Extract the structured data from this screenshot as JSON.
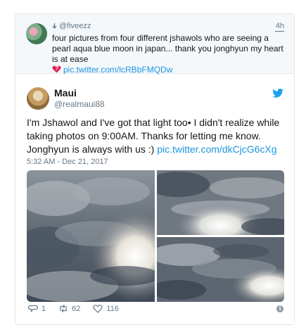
{
  "quoted": {
    "handle": "@fiveezz",
    "time": "4h",
    "text": "four pictures from four different jshawols who are seeing a pearl aqua blue moon in japan... thank you jonghyun my heart is at ease",
    "link": "pic.twitter.com/lcRBbFMQDw"
  },
  "tweet": {
    "name": "Maui",
    "handle": "@realmaui88",
    "text": "I'm Jshawol and I've got that light too• I didn't realize while taking photos on 9:00AM. Thanks for letting me know. Jonghyun is always with us :) ",
    "link": "pic.twitter.com/dkCjcG6cXg",
    "timestamp": "5:32 AM - Dec 21, 2017"
  },
  "actions": {
    "replies": "1",
    "retweets": "62",
    "likes": "116"
  },
  "icons": {
    "download": "arrow-down-icon",
    "heart": "heart-icon",
    "bird": "twitter-bird-icon",
    "reply": "reply-icon",
    "retweet": "retweet-icon",
    "like": "heart-outline-icon",
    "info": "info-icon"
  },
  "colors": {
    "link": "#1b95e0",
    "twitter_blue": "#1da1f2",
    "muted": "#657786",
    "heart": "#e0245e"
  }
}
